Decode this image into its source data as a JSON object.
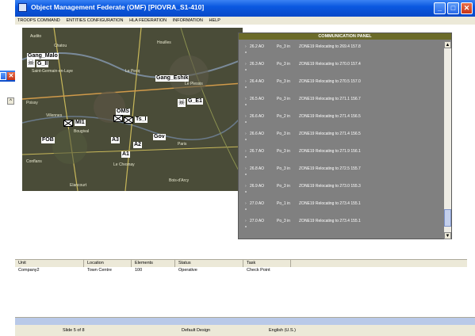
{
  "window": {
    "title": "Object Management Federate (OMF) [PIOVRA_S1-410]",
    "controls": {
      "minimize": "_",
      "maximize": "□",
      "close": "✕"
    }
  },
  "menu": [
    "TROOPS COMMAND",
    "ENTITIES CONFIGURATION",
    "HLA FEDERATION",
    "INFORMATION",
    "HELP"
  ],
  "map": {
    "places": [
      "Audito",
      "Chatou",
      "Houilles",
      "Saint-Germain-en-Laye",
      "Le Plessis",
      "Poissy",
      "Le Pecq",
      "Villennes",
      "Bougival",
      "Paris",
      "Conflans",
      "Elancourt",
      "Le Chesnay",
      "Bois-d'Arcy"
    ],
    "units": [
      "Gang_Malo",
      "G_II",
      "Gang_Eshik",
      "G_E1",
      "OMS",
      "MI1",
      "FOB",
      "A3",
      "A2",
      "A1",
      "Gov",
      "Ts_I"
    ]
  },
  "comm_panel": {
    "title": "COMMUNICATION PANEL",
    "messages": [
      {
        "time": "26.2 AO",
        "sender": "Po_3 in",
        "text": "ZONE19 Relocating to 269.4 157.8"
      },
      {
        "time": "26.3 AO",
        "sender": "Po_3 in",
        "text": "ZONE19 Relocating to 270.0 157.4"
      },
      {
        "time": "26.4 AO",
        "sender": "Po_3 in",
        "text": "ZONE19 Relocating to 270.5 157.0"
      },
      {
        "time": "26.5 AO",
        "sender": "Po_3 in",
        "text": "ZONE19 Relocating to 271.1 156.7"
      },
      {
        "time": "26.6 AO",
        "sender": "Po_2 in",
        "text": "ZONE19 Relocating to 271.4 156.5"
      },
      {
        "time": "26.6 AO",
        "sender": "Po_3 in",
        "text": "ZONE19 Relocating to 271.4 156.5"
      },
      {
        "time": "26.7 AO",
        "sender": "Po_3 in",
        "text": "ZONE19 Relocating to 271.9 156.1"
      },
      {
        "time": "26.8 AO",
        "sender": "Po_3 in",
        "text": "ZONE19 Relocating to 272.5 155.7"
      },
      {
        "time": "26.9 AO",
        "sender": "Po_3 in",
        "text": "ZONE19 Relocating to 273.0 155.3"
      },
      {
        "time": "27.0 AO",
        "sender": "Po_1 in",
        "text": "ZONE19 Relocating to 273.4 155.1"
      },
      {
        "time": "27.0 AO",
        "sender": "Po_3 in",
        "text": "ZONE19 Relocating to 273.4 155.1"
      }
    ]
  },
  "grid": {
    "columns": [
      "Unit",
      "Location",
      "Elements",
      "Status",
      "Task"
    ],
    "rows": [
      [
        "Company2",
        "Town Centre",
        "100",
        "Operative",
        "Check Point"
      ]
    ]
  },
  "statusbar": {
    "slide": "Slide 5 of 8",
    "design": "Default Design",
    "language": "English (U.S.)"
  },
  "colors": {
    "title_blue": "#0a58e0",
    "comm_bg": "#808080",
    "comm_header": "#6b6b2a"
  }
}
